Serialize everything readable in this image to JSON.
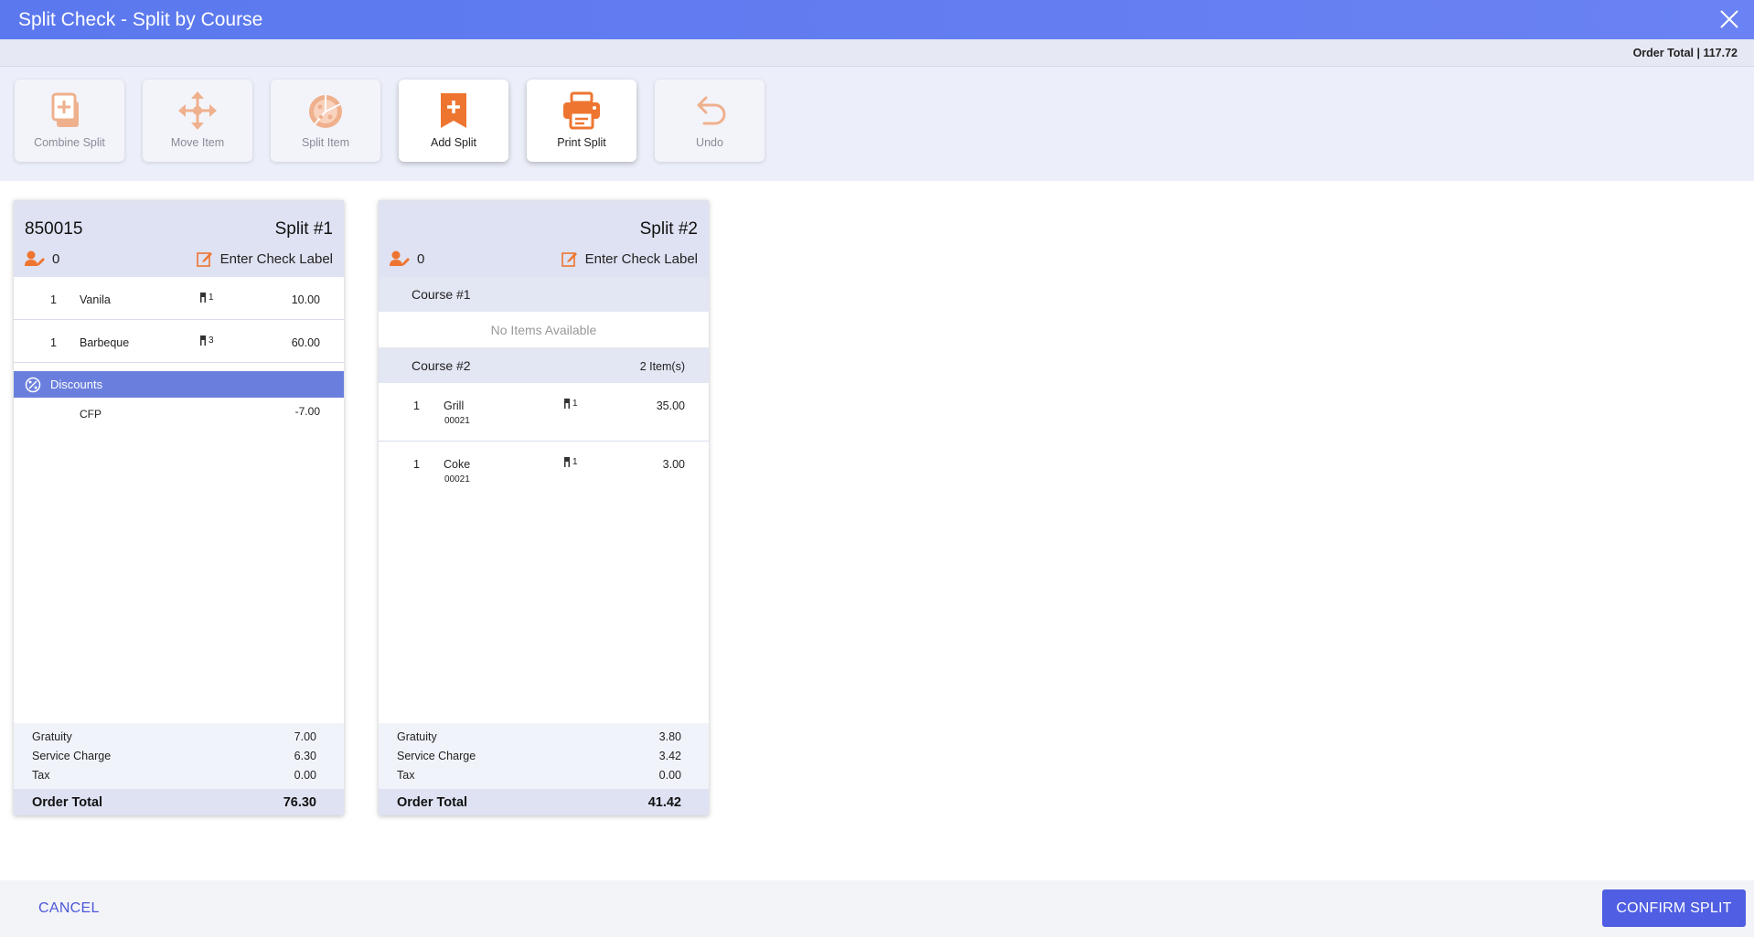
{
  "window": {
    "title": "Split Check - Split by Course"
  },
  "header": {
    "order_total": "Order Total | 117.72"
  },
  "toolbar": [
    {
      "label": "Combine Split",
      "icon": "combine-split-icon",
      "active": false
    },
    {
      "label": "Move Item",
      "icon": "move-item-icon",
      "active": false
    },
    {
      "label": "Split Item",
      "icon": "split-item-icon",
      "active": false
    },
    {
      "label": "Add Split",
      "icon": "add-split-icon",
      "active": true
    },
    {
      "label": "Print Split",
      "icon": "print-split-icon",
      "active": true
    },
    {
      "label": "Undo",
      "icon": "undo-icon",
      "active": false
    }
  ],
  "colors": {
    "accent": "#5b78ee",
    "orange": "#ee7530",
    "orange_faded": "#efb08d",
    "discount_band": "#6a7fdd"
  },
  "split1": {
    "check_number": "850015",
    "title": "Split #1",
    "guests": "0",
    "label_placeholder": "Enter Check Label",
    "items": [
      {
        "qty": "1",
        "name": "Vanila",
        "seat": "1",
        "price": "10.00"
      },
      {
        "qty": "1",
        "name": "Barbeque",
        "seat": "3",
        "price": "60.00"
      }
    ],
    "discounts_title": "Discounts",
    "discount": {
      "name": "CFP",
      "amount": "-7.00"
    },
    "summary": {
      "gratuity_label": "Gratuity",
      "gratuity": "7.00",
      "service_label": "Service Charge",
      "service": "6.30",
      "tax_label": "Tax",
      "tax": "0.00",
      "total_label": "Order Total",
      "total": "76.30"
    }
  },
  "split2": {
    "title": "Split #2",
    "guests": "0",
    "label_placeholder": "Enter Check Label",
    "course1": {
      "name": "Course #1",
      "empty": "No Items Available"
    },
    "course2": {
      "name": "Course #2",
      "count": "2 Item(s)"
    },
    "items": [
      {
        "qty": "1",
        "name": "Grill",
        "code": "00021",
        "seat": "1",
        "price": "35.00"
      },
      {
        "qty": "1",
        "name": "Coke",
        "code": "00021",
        "seat": "1",
        "price": "3.00"
      }
    ],
    "summary": {
      "gratuity_label": "Gratuity",
      "gratuity": "3.80",
      "service_label": "Service Charge",
      "service": "3.42",
      "tax_label": "Tax",
      "tax": "0.00",
      "total_label": "Order Total",
      "total": "41.42"
    }
  },
  "footer": {
    "cancel": "CANCEL",
    "confirm": "CONFIRM SPLIT"
  }
}
